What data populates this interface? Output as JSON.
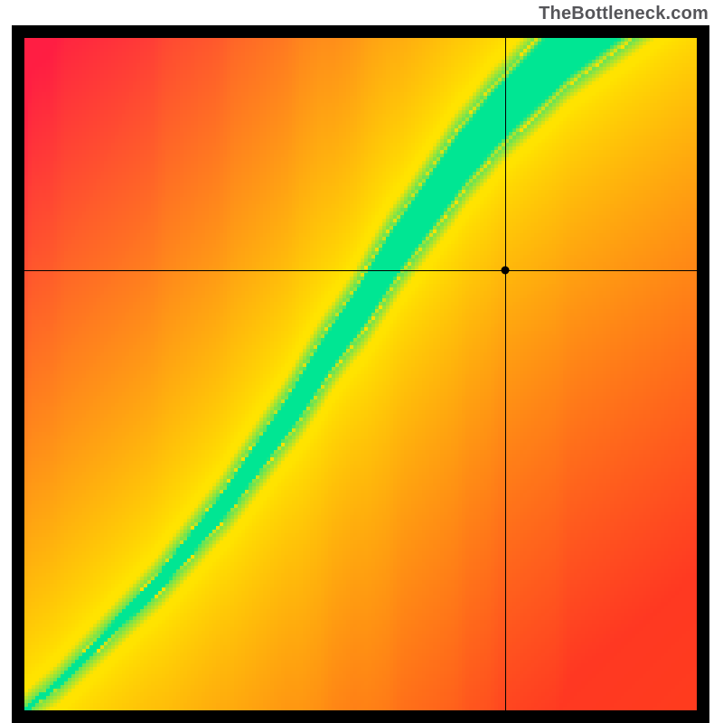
{
  "watermark": "TheBottleneck.com",
  "chart_data": {
    "type": "heatmap",
    "title": "",
    "xlabel": "",
    "ylabel": "",
    "xlim": [
      0,
      1
    ],
    "ylim": [
      0,
      1
    ],
    "crosshair": {
      "x": 0.715,
      "y": 0.655
    },
    "marker": {
      "x": 0.715,
      "y": 0.655
    },
    "ridge": [
      {
        "x": 0.0,
        "y": 0.0
      },
      {
        "x": 0.05,
        "y": 0.04
      },
      {
        "x": 0.1,
        "y": 0.09
      },
      {
        "x": 0.15,
        "y": 0.14
      },
      {
        "x": 0.2,
        "y": 0.19
      },
      {
        "x": 0.25,
        "y": 0.25
      },
      {
        "x": 0.3,
        "y": 0.31
      },
      {
        "x": 0.35,
        "y": 0.38
      },
      {
        "x": 0.4,
        "y": 0.45
      },
      {
        "x": 0.45,
        "y": 0.53
      },
      {
        "x": 0.5,
        "y": 0.6
      },
      {
        "x": 0.55,
        "y": 0.68
      },
      {
        "x": 0.6,
        "y": 0.75
      },
      {
        "x": 0.65,
        "y": 0.82
      },
      {
        "x": 0.7,
        "y": 0.88
      },
      {
        "x": 0.75,
        "y": 0.93
      },
      {
        "x": 0.8,
        "y": 0.98
      },
      {
        "x": 0.85,
        "y": 1.02
      },
      {
        "x": 0.9,
        "y": 1.06
      },
      {
        "x": 0.95,
        "y": 1.1
      },
      {
        "x": 1.0,
        "y": 1.14
      }
    ],
    "colors": {
      "optimal": "#00E693",
      "warn": "#FFE300",
      "bad_low": "#FF2A3C",
      "bad_high": "#FF2A3C"
    },
    "resolution": 186
  }
}
